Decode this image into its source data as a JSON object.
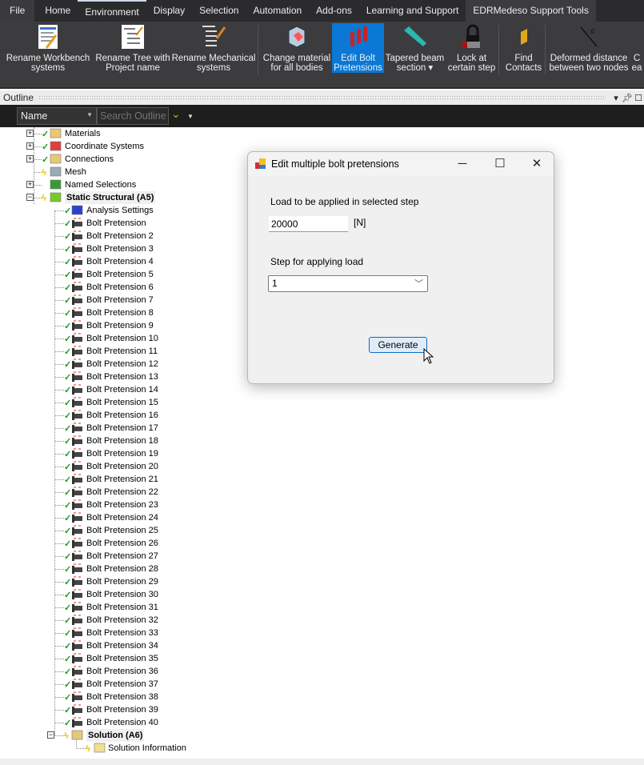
{
  "ribbon_tabs": [
    "File",
    "Home",
    "Environment",
    "Display",
    "Selection",
    "Automation",
    "Add-ons",
    "Learning and Support",
    "EDRMedeso Support Tools"
  ],
  "active_tab": "EDRMedeso Support Tools",
  "ribbon_buttons": [
    {
      "label1": "Rename Workbench",
      "label2": "systems",
      "icon": "workbench-list-icon"
    },
    {
      "label1": "Rename Tree with",
      "label2": "Project name",
      "icon": "tree-rename-icon"
    },
    {
      "label1": "Rename Mechanical",
      "label2": "systems",
      "icon": "mechanical-tree-icon"
    },
    {
      "label1": "Change material",
      "label2": "for all bodies",
      "icon": "material-cube-icon"
    },
    {
      "label1": "Edit Bolt",
      "label2": "Pretensions",
      "icon": "bolt-icon",
      "selected": true
    },
    {
      "label1": "Tapered beam",
      "label2": "section ▾",
      "icon": "tapered-beam-icon"
    },
    {
      "label1": "Lock at",
      "label2": "certain step",
      "icon": "lock-icon"
    },
    {
      "label1": "Find",
      "label2": "Contacts",
      "icon": "contact-icon"
    },
    {
      "label1": "Deformed distance",
      "label2": "between two nodes",
      "icon": "distance-icon"
    },
    {
      "label1": "C",
      "label2": "ea",
      "icon": "partial-icon"
    }
  ],
  "outline": {
    "title": "Outline",
    "name_filter": "Name",
    "search_placeholder": "Search Outline"
  },
  "tree": [
    {
      "label": "Materials",
      "level": 1,
      "expander": "+",
      "status": "check",
      "icon": "materials-folder-icon"
    },
    {
      "label": "Coordinate Systems",
      "level": 1,
      "expander": "+",
      "status": "check",
      "icon": "coordinate-systems-icon"
    },
    {
      "label": "Connections",
      "level": 1,
      "expander": "+",
      "status": "check",
      "icon": "connections-folder-icon"
    },
    {
      "label": "Mesh",
      "level": 1,
      "expander": "",
      "status": "bolt",
      "icon": "mesh-icon"
    },
    {
      "label": "Named Selections",
      "level": 1,
      "expander": "+",
      "status": "",
      "icon": "named-selections-icon"
    },
    {
      "label": "Static Structural (A5)",
      "level": 1,
      "expander": "-",
      "status": "bolt",
      "icon": "static-structural-icon",
      "bold": true
    },
    {
      "label": "Analysis Settings",
      "level": 2,
      "status": "check",
      "icon": "analysis-settings-icon"
    },
    {
      "label": "Bolt Pretension",
      "level": 2,
      "status": "check",
      "icon": "bolt-pretension-icon"
    },
    {
      "label": "Bolt Pretension 2",
      "level": 2,
      "status": "check",
      "icon": "bolt-pretension-icon"
    },
    {
      "label": "Bolt Pretension 3",
      "level": 2,
      "status": "check",
      "icon": "bolt-pretension-icon"
    },
    {
      "label": "Bolt Pretension 4",
      "level": 2,
      "status": "check",
      "icon": "bolt-pretension-icon"
    },
    {
      "label": "Bolt Pretension 5",
      "level": 2,
      "status": "check",
      "icon": "bolt-pretension-icon"
    },
    {
      "label": "Bolt Pretension 6",
      "level": 2,
      "status": "check",
      "icon": "bolt-pretension-icon"
    },
    {
      "label": "Bolt Pretension 7",
      "level": 2,
      "status": "check",
      "icon": "bolt-pretension-icon"
    },
    {
      "label": "Bolt Pretension 8",
      "level": 2,
      "status": "check",
      "icon": "bolt-pretension-icon"
    },
    {
      "label": "Bolt Pretension 9",
      "level": 2,
      "status": "check",
      "icon": "bolt-pretension-icon"
    },
    {
      "label": "Bolt Pretension 10",
      "level": 2,
      "status": "check",
      "icon": "bolt-pretension-icon"
    },
    {
      "label": "Bolt Pretension 11",
      "level": 2,
      "status": "check",
      "icon": "bolt-pretension-icon"
    },
    {
      "label": "Bolt Pretension 12",
      "level": 2,
      "status": "check",
      "icon": "bolt-pretension-icon"
    },
    {
      "label": "Bolt Pretension 13",
      "level": 2,
      "status": "check",
      "icon": "bolt-pretension-icon"
    },
    {
      "label": "Bolt Pretension 14",
      "level": 2,
      "status": "check",
      "icon": "bolt-pretension-icon"
    },
    {
      "label": "Bolt Pretension 15",
      "level": 2,
      "status": "check",
      "icon": "bolt-pretension-icon"
    },
    {
      "label": "Bolt Pretension 16",
      "level": 2,
      "status": "check",
      "icon": "bolt-pretension-icon"
    },
    {
      "label": "Bolt Pretension 17",
      "level": 2,
      "status": "check",
      "icon": "bolt-pretension-icon"
    },
    {
      "label": "Bolt Pretension 18",
      "level": 2,
      "status": "check",
      "icon": "bolt-pretension-icon"
    },
    {
      "label": "Bolt Pretension 19",
      "level": 2,
      "status": "check",
      "icon": "bolt-pretension-icon"
    },
    {
      "label": "Bolt Pretension 20",
      "level": 2,
      "status": "check",
      "icon": "bolt-pretension-icon"
    },
    {
      "label": "Bolt Pretension 21",
      "level": 2,
      "status": "check",
      "icon": "bolt-pretension-icon"
    },
    {
      "label": "Bolt Pretension 22",
      "level": 2,
      "status": "check",
      "icon": "bolt-pretension-icon"
    },
    {
      "label": "Bolt Pretension 23",
      "level": 2,
      "status": "check",
      "icon": "bolt-pretension-icon"
    },
    {
      "label": "Bolt Pretension 24",
      "level": 2,
      "status": "check",
      "icon": "bolt-pretension-icon"
    },
    {
      "label": "Bolt Pretension 25",
      "level": 2,
      "status": "check",
      "icon": "bolt-pretension-icon"
    },
    {
      "label": "Bolt Pretension 26",
      "level": 2,
      "status": "check",
      "icon": "bolt-pretension-icon"
    },
    {
      "label": "Bolt Pretension 27",
      "level": 2,
      "status": "check",
      "icon": "bolt-pretension-icon"
    },
    {
      "label": "Bolt Pretension 28",
      "level": 2,
      "status": "check",
      "icon": "bolt-pretension-icon"
    },
    {
      "label": "Bolt Pretension 29",
      "level": 2,
      "status": "check",
      "icon": "bolt-pretension-icon"
    },
    {
      "label": "Bolt Pretension 30",
      "level": 2,
      "status": "check",
      "icon": "bolt-pretension-icon"
    },
    {
      "label": "Bolt Pretension 31",
      "level": 2,
      "status": "check",
      "icon": "bolt-pretension-icon"
    },
    {
      "label": "Bolt Pretension 32",
      "level": 2,
      "status": "check",
      "icon": "bolt-pretension-icon"
    },
    {
      "label": "Bolt Pretension 33",
      "level": 2,
      "status": "check",
      "icon": "bolt-pretension-icon"
    },
    {
      "label": "Bolt Pretension 34",
      "level": 2,
      "status": "check",
      "icon": "bolt-pretension-icon"
    },
    {
      "label": "Bolt Pretension 35",
      "level": 2,
      "status": "check",
      "icon": "bolt-pretension-icon"
    },
    {
      "label": "Bolt Pretension 36",
      "level": 2,
      "status": "check",
      "icon": "bolt-pretension-icon"
    },
    {
      "label": "Bolt Pretension 37",
      "level": 2,
      "status": "check",
      "icon": "bolt-pretension-icon"
    },
    {
      "label": "Bolt Pretension 38",
      "level": 2,
      "status": "check",
      "icon": "bolt-pretension-icon"
    },
    {
      "label": "Bolt Pretension 39",
      "level": 2,
      "status": "check",
      "icon": "bolt-pretension-icon"
    },
    {
      "label": "Bolt Pretension 40",
      "level": 2,
      "status": "check",
      "icon": "bolt-pretension-icon"
    },
    {
      "label": "Solution (A6)",
      "level": 2,
      "expander": "-",
      "status": "bolt",
      "icon": "solution-icon",
      "bold": true
    },
    {
      "label": "Solution Information",
      "level": 3,
      "status": "bolt",
      "icon": "solution-information-icon"
    }
  ],
  "dialog": {
    "title": "Edit multiple bolt pretensions",
    "load_label": "Load to be applied in selected step",
    "load_value": "20000",
    "unit": "[N]",
    "step_label": "Step for applying load",
    "step_value": "1",
    "generate_label": "Generate"
  },
  "colors": {
    "accent": "#0a78d4",
    "check": "#1a9a1a",
    "pending": "#e8c000"
  }
}
